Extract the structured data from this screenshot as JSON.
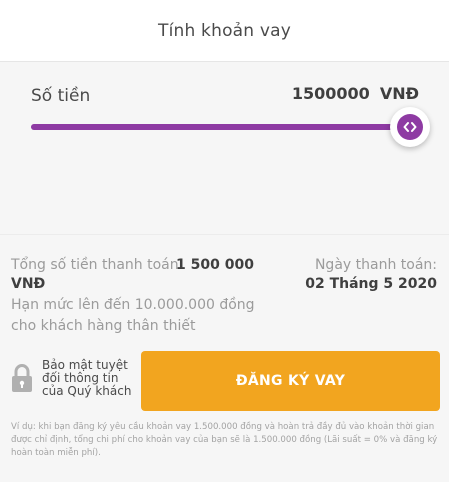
{
  "header": {
    "title": "Tính khoản vay"
  },
  "amount": {
    "label": "Số tiền",
    "value": "1500000",
    "currency": "VNĐ",
    "slider_fraction": 0.97,
    "thumb_icon": "code-arrows-icon"
  },
  "summary": {
    "total_label": "Tổng số tiền thanh toán:",
    "total_value": "1 500 000",
    "total_currency": "VNĐ",
    "limit_text": "Hạn mức lên đến 10.000.000 đồng cho khách hàng thân thiết",
    "date_label": "Ngày thanh toán:",
    "date_value": "02 Tháng 5 2020"
  },
  "security": {
    "icon": "lock-icon",
    "text": "Bảo mật tuyệt đối thông tin của Quý khách"
  },
  "register_button": {
    "label": "ĐĂNG KÝ VAY"
  },
  "disclaimer": "Ví dụ: khi bạn đăng ký yêu cầu khoản vay 1.500.000 đồng và hoàn trả đầy đủ vào khoản thời gian được chỉ định, tổng chi phí cho khoản vay của bạn sẽ là 1.500.000 đồng (Lãi suất = 0% và đăng ký hoàn toàn miễn phí).",
  "colors": {
    "accent": "#8e3aa3",
    "button": "#f2a51f",
    "panel_bg": "#f6f6f6"
  }
}
